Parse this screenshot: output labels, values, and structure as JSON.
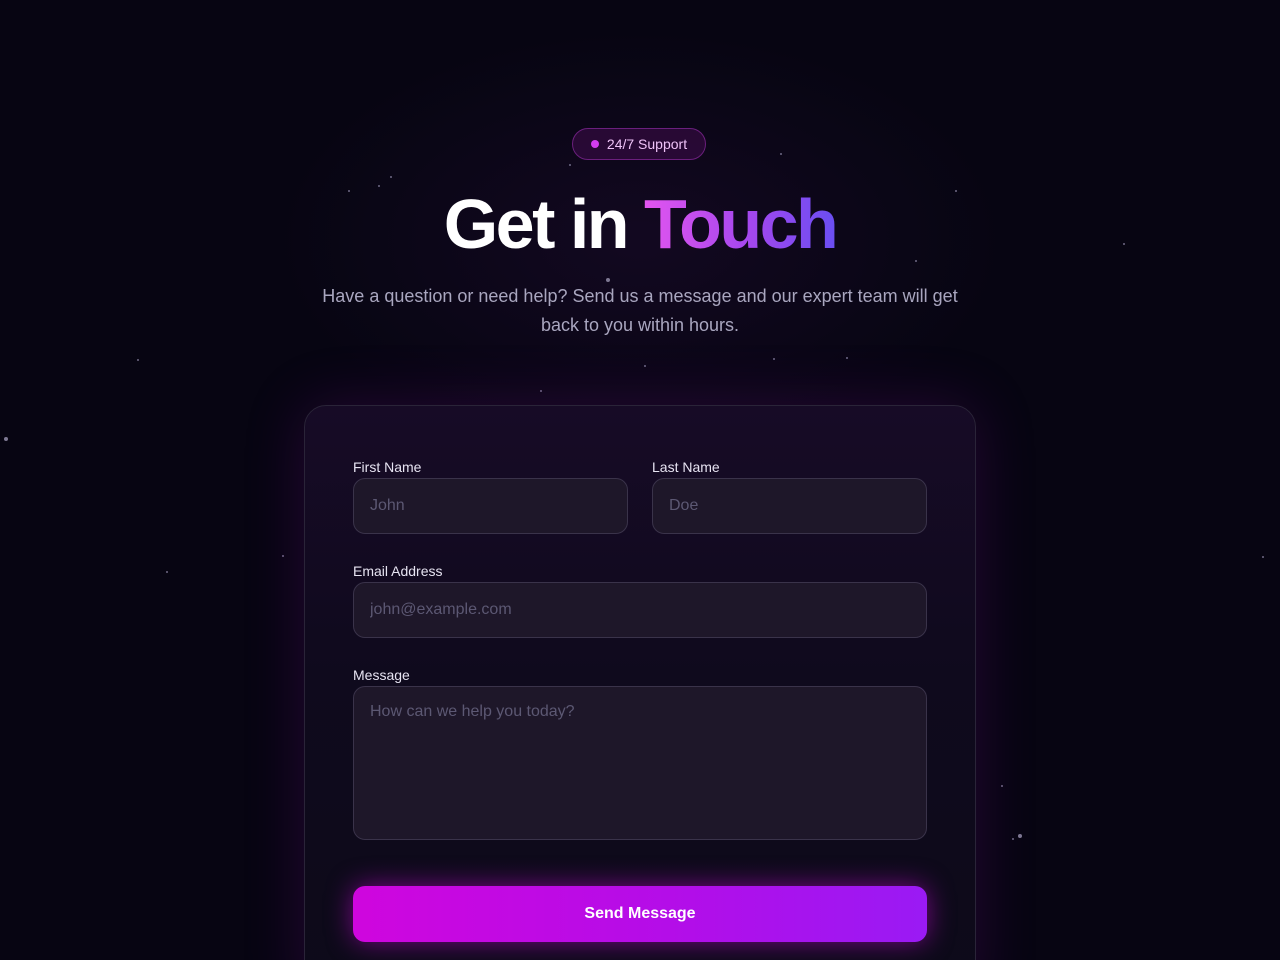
{
  "badge": {
    "label": "24/7 Support",
    "dot_color": "#d33cf0"
  },
  "hero": {
    "title_plain": "Get in",
    "title_accent": "Touch",
    "subtitle": "Have a question or need help? Send us a message and our expert team will get back to you within hours."
  },
  "form": {
    "first_name": {
      "label": "First Name",
      "placeholder": "John",
      "value": ""
    },
    "last_name": {
      "label": "Last Name",
      "placeholder": "Doe",
      "value": ""
    },
    "email": {
      "label": "Email Address",
      "placeholder": "john@example.com",
      "value": ""
    },
    "message": {
      "label": "Message",
      "placeholder": "How can we help you today?",
      "value": ""
    },
    "submit_label": "Send Message"
  },
  "colors": {
    "background": "#070512",
    "accent_gradient": [
      "#e255ef",
      "#6a4ef2"
    ],
    "button_gradient": [
      "#cf06de",
      "#9a1af4"
    ]
  }
}
